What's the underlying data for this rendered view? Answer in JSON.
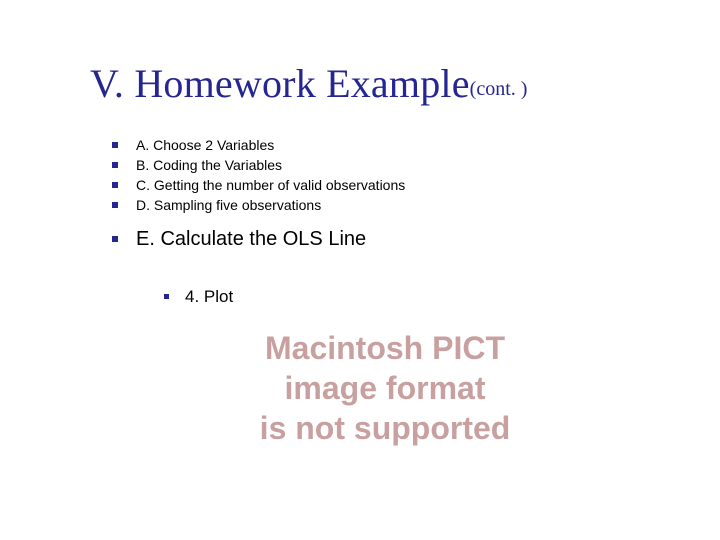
{
  "title": {
    "main": "V. Homework Example",
    "suffix": "(cont. )"
  },
  "bullets": [
    {
      "text": "A. Choose 2 Variables"
    },
    {
      "text": "B. Coding the Variables"
    },
    {
      "text": "C. Getting the number of valid observations"
    },
    {
      "text": "D. Sampling five observations"
    }
  ],
  "emphasis": {
    "text": "E. Calculate the OLS Line"
  },
  "sub": {
    "text": "4. Plot"
  },
  "pict_error": {
    "line1": "Macintosh PICT",
    "line2": "image format",
    "line3": "is not supported"
  }
}
